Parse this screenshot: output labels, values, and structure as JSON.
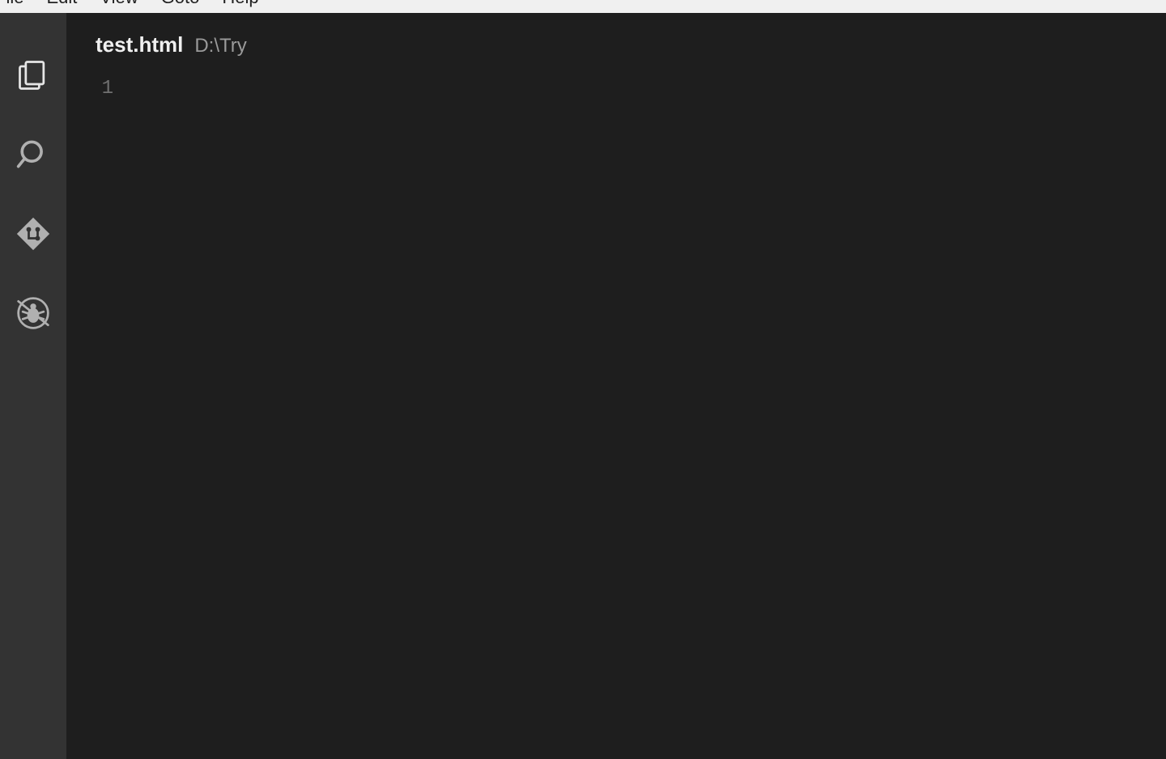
{
  "menubar": {
    "items": [
      "File",
      "Edit",
      "View",
      "Goto",
      "Help"
    ]
  },
  "activitybar": {
    "icons": [
      {
        "name": "explorer-icon",
        "active": true
      },
      {
        "name": "search-icon",
        "active": false
      },
      {
        "name": "source-control-icon",
        "active": false
      },
      {
        "name": "debug-icon",
        "active": false
      }
    ]
  },
  "editor": {
    "active_tab": {
      "filename": "test.html",
      "path": "D:\\Try"
    },
    "line_numbers": [
      "1"
    ],
    "content": ""
  }
}
